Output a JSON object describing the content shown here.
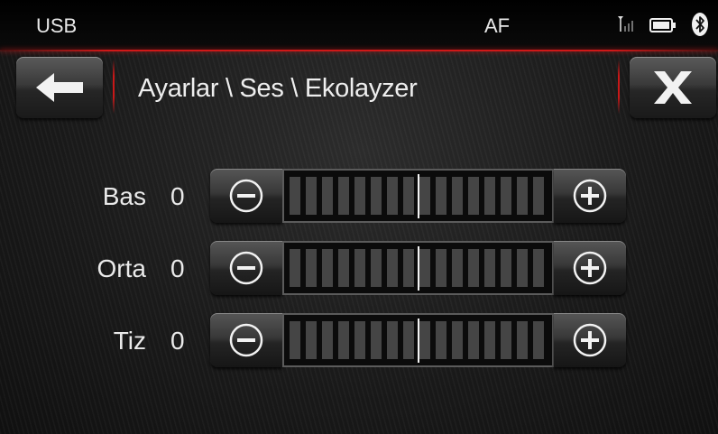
{
  "status_bar": {
    "source": "USB",
    "band": "AF",
    "icons": [
      "signal-icon",
      "battery-icon",
      "bluetooth-icon"
    ]
  },
  "header": {
    "breadcrumb": "Ayarlar \\ Ses \\ Ekolayzer",
    "back_icon": "arrow-left-icon",
    "close_icon": "close-x-icon"
  },
  "equalizer": {
    "rows": [
      {
        "label": "Bas",
        "value": "0",
        "level": 0
      },
      {
        "label": "Orta",
        "value": "0",
        "level": 0
      },
      {
        "label": "Tiz",
        "value": "0",
        "level": 0
      }
    ]
  },
  "colors": {
    "accent_red": "#d01818",
    "background": "#141414",
    "text": "#eaeaea"
  }
}
